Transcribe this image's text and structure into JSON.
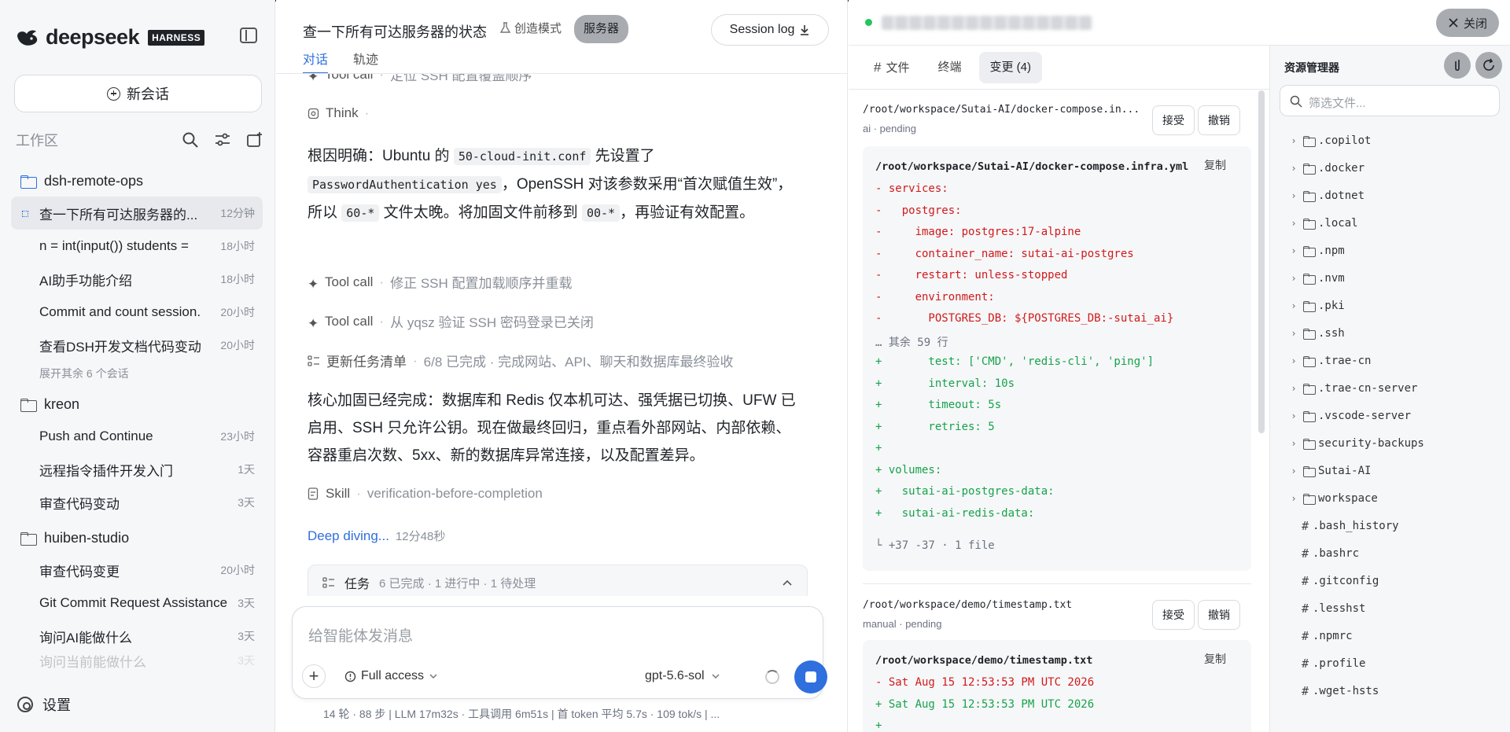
{
  "brand": {
    "name": "deepseek",
    "badge": "HARNESS"
  },
  "sidebar": {
    "new_chat_label": "新会话",
    "workspace_label": "工作区",
    "groups": [
      {
        "name": "dsh-remote-ops",
        "conversations": [
          {
            "title": "查一下所有可达服务器的...",
            "time": "12分钟"
          },
          {
            "title": "n = int(input()) students =",
            "time": "18小时"
          },
          {
            "title": "AI助手功能介绍",
            "time": "18小时"
          },
          {
            "title": "Commit and count session.",
            "time": "20小时"
          },
          {
            "title": "查看DSH开发文档代码变动",
            "time": "20小时"
          }
        ],
        "expand_more": "展开其余 6 个会话"
      },
      {
        "name": "kreon",
        "conversations": [
          {
            "title": "Push and Continue",
            "time": "23小时"
          },
          {
            "title": "远程指令插件开发入门",
            "time": "1天"
          },
          {
            "title": "审查代码变动",
            "time": "3天"
          }
        ]
      },
      {
        "name": "huiben-studio",
        "conversations": [
          {
            "title": "审查代码变更",
            "time": "20小时"
          },
          {
            "title": "Git Commit Request Assistance",
            "time": "3天"
          },
          {
            "title": "询问AI能做什么",
            "time": "3天"
          },
          {
            "title": "询问当前能做什么",
            "time": "3天"
          }
        ]
      }
    ],
    "settings_label": "设置"
  },
  "chat": {
    "title": "查一下所有可达服务器的状态",
    "mode": "创造模式",
    "server_tag": "服务器",
    "session_log": "Session log",
    "tabs": [
      "对话",
      "轨迹"
    ],
    "steps": {
      "tool_call_top": {
        "label": "Tool call",
        "desc": "定位 SSH 配置覆盖顺序"
      },
      "think": {
        "label": "Think",
        "desc": "·"
      },
      "tool_call_1": {
        "label": "Tool call",
        "desc": "修正 SSH 配置加载顺序并重载"
      },
      "tool_call_2": {
        "label": "Tool call",
        "desc": "从 yqsz 验证 SSH 密码登录已关闭"
      },
      "task_update": {
        "label": "更新任务清单",
        "desc": "6/8 已完成 · 完成网站、API、聊天和数据库最终验收"
      },
      "skill": {
        "label": "Skill",
        "desc": "verification-before-completion"
      }
    },
    "para1": {
      "t1": "根因明确：Ubuntu 的 ",
      "c1": "50-cloud-init.conf",
      "t2": " 先设置了 ",
      "c2": "PasswordAuthentication yes",
      "t3": "，OpenSSH 对该参数采用“首次赋值生效”，所以 ",
      "c3": "60-*",
      "t4": " 文件太晚。将加固文件前移到 ",
      "c4": "00-*",
      "t5": "，再验证有效配置。"
    },
    "para2": "核心加固已经完成：数据库和 Redis 仅本机可达、强凭据已切换、UFW 已启用、SSH 只允许公钥。现在做最终回归，重点看外部网站、内部依赖、容器重启次数、5xx、新的数据库异常连接，以及配置差异。",
    "deep_diving": "Deep diving...",
    "deep_diving_time": "12分48秒",
    "task_bar": {
      "label": "任务",
      "summary": "6 已完成 · 1 进行中 · 1 待处理"
    },
    "input_placeholder": "给智能体发消息",
    "access": "Full access",
    "model": "gpt-5.6-sol",
    "stats": "14 轮 · 88 步   |   LLM 17m32s · 工具调用 6m51s   |   首 token 平均 5.7s · 109 tok/s   |   ..."
  },
  "right": {
    "close_label": "关闭",
    "tabs": [
      "文件",
      "终端",
      "变更 (4)"
    ],
    "changes": [
      {
        "path_short": "/root/workspace/Sutai-AI/docker-compose.in...",
        "meta": "ai · pending",
        "accept": "接受",
        "revert": "撤销",
        "path_full": "/root/workspace/Sutai-AI/docker-compose.infra.yml",
        "copy": "复制",
        "lines": [
          "- services:",
          "-   postgres:",
          "-     image: postgres:17-alpine",
          "-     container_name: sutai-ai-postgres",
          "-     restart: unless-stopped",
          "-     environment:",
          "-       POSTGRES_DB: ${POSTGRES_DB:-sutai_ai}",
          "… 其余 59 行",
          "+       test: ['CMD', 'redis-cli', 'ping']",
          "+       interval: 10s",
          "+       timeout: 5s",
          "+       retries: 5",
          "+",
          "+ volumes:",
          "+   sutai-ai-postgres-data:",
          "+   sutai-ai-redis-data:"
        ],
        "summary": "└ +37 -37 · 1 file"
      },
      {
        "path_short": "/root/workspace/demo/timestamp.txt",
        "meta": "manual · pending",
        "accept": "接受",
        "revert": "撤销",
        "path_full": "/root/workspace/demo/timestamp.txt",
        "copy": "复制",
        "lines": [
          "- Sat Aug 15 12:53:53 PM UTC 2026",
          "+ Sat Aug 15 12:53:53 PM UTC 2026",
          "+"
        ]
      }
    ],
    "tree": {
      "title": "资源管理器",
      "filter_placeholder": "筛选文件...",
      "items": [
        {
          "type": "folder",
          "name": ".copilot"
        },
        {
          "type": "folder",
          "name": ".docker"
        },
        {
          "type": "folder",
          "name": ".dotnet"
        },
        {
          "type": "folder",
          "name": ".local"
        },
        {
          "type": "folder",
          "name": ".npm"
        },
        {
          "type": "folder",
          "name": ".nvm"
        },
        {
          "type": "folder",
          "name": ".pki"
        },
        {
          "type": "folder",
          "name": ".ssh"
        },
        {
          "type": "folder",
          "name": ".trae-cn"
        },
        {
          "type": "folder",
          "name": ".trae-cn-server"
        },
        {
          "type": "folder",
          "name": ".vscode-server"
        },
        {
          "type": "folder",
          "name": "security-backups"
        },
        {
          "type": "folder",
          "name": "Sutai-AI"
        },
        {
          "type": "folder",
          "name": "workspace"
        },
        {
          "type": "file",
          "name": ".bash_history"
        },
        {
          "type": "file",
          "name": ".bashrc"
        },
        {
          "type": "file",
          "name": ".gitconfig"
        },
        {
          "type": "file",
          "name": ".lesshst"
        },
        {
          "type": "file",
          "name": ".npmrc"
        },
        {
          "type": "file",
          "name": ".profile"
        },
        {
          "type": "file",
          "name": ".wget-hsts"
        }
      ]
    }
  }
}
